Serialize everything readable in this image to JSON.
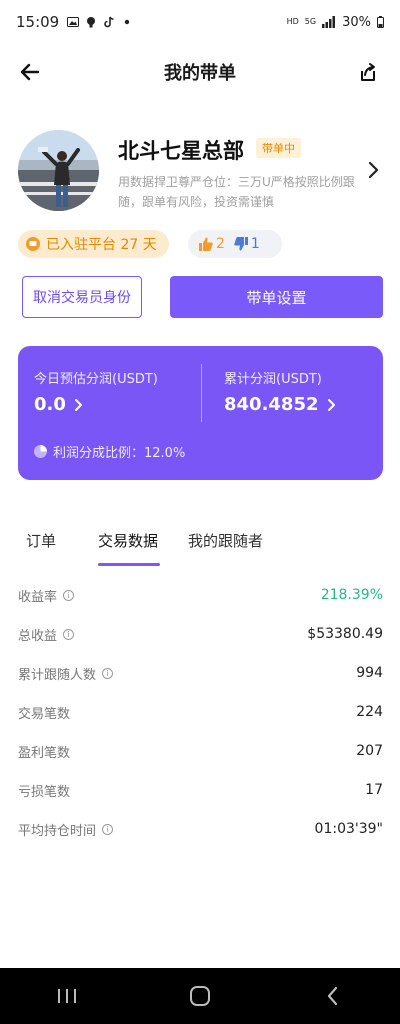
{
  "status_bar": {
    "time": "15:09",
    "network_hd": "HD",
    "network_5g": "5G",
    "battery": "30%"
  },
  "header": {
    "title": "我的带单"
  },
  "profile": {
    "name": "北斗七星总部",
    "badge": "带单中",
    "bio": "用数据捍卫尊严仓位：三万U严格按照比例跟随，跟单有风险，投资需谨慎",
    "joined": "已入驻平台 27 天",
    "likes": "2",
    "dislikes": "1"
  },
  "actions": {
    "cancel_trader": "取消交易员身份",
    "settings": "带单设置"
  },
  "card": {
    "today_label": "今日预估分润(USDT)",
    "today_value": "0.0",
    "total_label": "累计分润(USDT)",
    "total_value": "840.4852",
    "ratio": "利润分成比例：12.0%"
  },
  "tabs": [
    "订单",
    "交易数据",
    "我的跟随者"
  ],
  "stats": [
    {
      "label": "收益率",
      "value": "218.39%",
      "has_info": true
    },
    {
      "label": "总收益",
      "value": "$53380.49",
      "has_info": true
    },
    {
      "label": "累计跟随人数",
      "value": "994",
      "has_info": true
    },
    {
      "label": "交易笔数",
      "value": "224",
      "has_info": false
    },
    {
      "label": "盈利笔数",
      "value": "207",
      "has_info": false
    },
    {
      "label": "亏损笔数",
      "value": "17",
      "has_info": false
    },
    {
      "label": "平均持仓时间",
      "value": "01:03'39\"",
      "has_info": true
    }
  ],
  "colors": {
    "accent": "#7a5af8",
    "positive": "#2bb38a",
    "badge_text": "#e08a00"
  }
}
